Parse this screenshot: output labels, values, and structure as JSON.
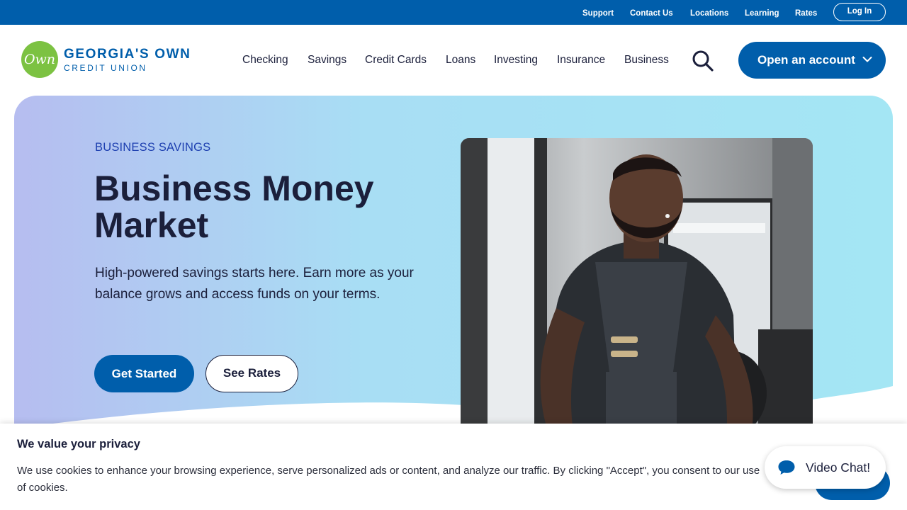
{
  "utility_nav": {
    "support": "Support",
    "contact_us": "Contact Us",
    "locations": "Locations",
    "learning": "Learning",
    "rates": "Rates",
    "log_in": "Log In"
  },
  "logo": {
    "mark": "Own",
    "line1": "GEORGIA'S OWN",
    "line2": "CREDIT UNION"
  },
  "main_nav": {
    "items": [
      "Checking",
      "Savings",
      "Credit Cards",
      "Loans",
      "Investing",
      "Insurance",
      "Business"
    ],
    "open_account": "Open an account"
  },
  "hero": {
    "eyebrow": "BUSINESS SAVINGS",
    "title": "Business Money Market",
    "lead": "High-powered savings starts here. Earn more as your balance grows and access funds on your terms.",
    "primary_cta": "Get Started",
    "secondary_cta": "See Rates"
  },
  "cookie_banner": {
    "title": "We value your privacy",
    "body": "We use cookies to enhance your browsing experience, serve personalized ads or content, and analyze our traffic. By clicking \"Accept\", you consent to our use of cookies."
  },
  "video_chat": {
    "label": "Video Chat!"
  },
  "colors": {
    "brand_blue": "#005eab",
    "brand_green": "#7cc242",
    "text_dark": "#1b1f3b",
    "eyebrow_blue": "#1d3fb0"
  },
  "icons": [
    "search-icon",
    "chevron-down-icon",
    "chat-bubble-icon"
  ]
}
